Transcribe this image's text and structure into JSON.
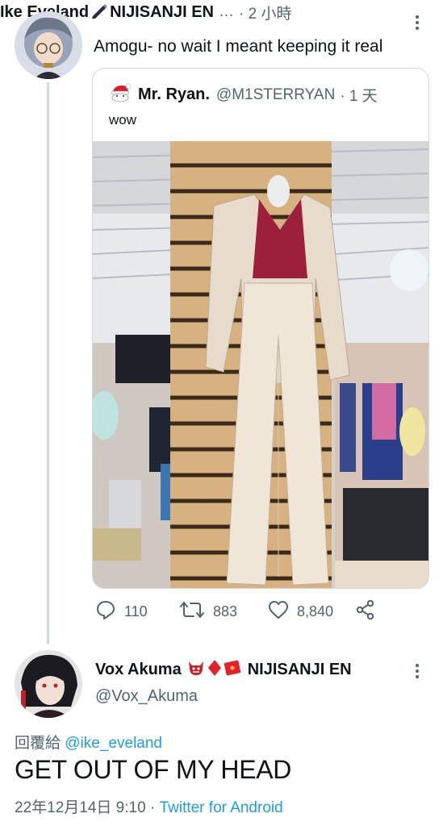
{
  "ike_tweet": {
    "display_name": "Ike Eveland",
    "name_suffix": "NIJISANJI EN",
    "ellipsis": "…",
    "time": "· 2 小時",
    "text": "Amogu- no wait I meant keeping it real",
    "icons": [
      "pen-icon",
      "more-icon"
    ]
  },
  "quoted_tweet": {
    "display_name": "Mr. Ryan.",
    "handle": "@M1STERRYAN",
    "time": "· 1 天",
    "text": "wow",
    "image_alt": "Beige pantsuit with red blouse on a mannequin hanging on a store pillar",
    "icons": [
      "santa-avatar-icon"
    ]
  },
  "actions": {
    "replies": "110",
    "retweets": "883",
    "likes": "8,840",
    "icons": [
      "reply-icon",
      "retweet-icon",
      "like-icon",
      "share-icon"
    ]
  },
  "vox_tweet": {
    "display_name": "Vox Akuma",
    "name_suffix": "NIJISANJI EN",
    "handle": "@Vox_Akuma",
    "reply_prefix": "回覆給",
    "reply_to": "@ike_eveland",
    "text": "GET OUT OF MY HEAD",
    "date": "22年12月14日 9:10",
    "separator": "·",
    "source": "Twitter for Android",
    "icons": [
      "demon-icon",
      "red-diamond-icon",
      "red-envelope-icon",
      "more-icon"
    ]
  },
  "colors": {
    "link": "#1d9bf0",
    "muted": "#536471",
    "border": "#cfd9de"
  }
}
